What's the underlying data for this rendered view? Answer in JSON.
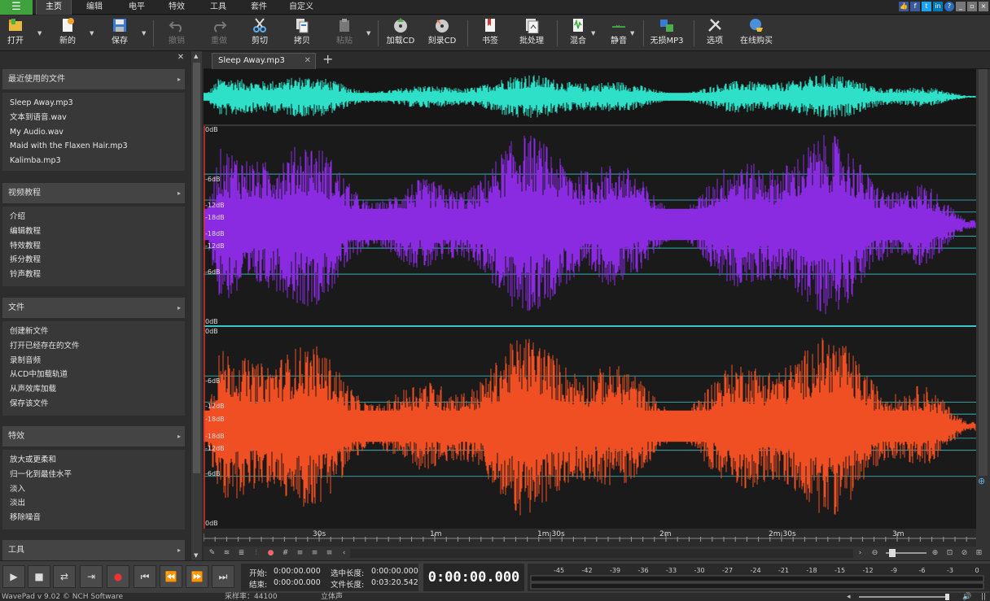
{
  "menu": {
    "items": [
      "主页",
      "编辑",
      "电平",
      "特效",
      "工具",
      "套件",
      "自定义"
    ]
  },
  "toolbar": {
    "open": "打开",
    "new": "新的",
    "save": "保存",
    "undo": "撤销",
    "redo": "重做",
    "cut": "剪切",
    "copy": "拷贝",
    "paste": "粘贴",
    "load_cd": "加载CD",
    "burn_cd": "刻录CD",
    "bookmark": "书签",
    "batch": "批处理",
    "mix": "混合",
    "silence": "静音",
    "lossless_mp3": "无损MP3",
    "options": "选项",
    "buy_online": "在线购买"
  },
  "sidebar": {
    "recent": {
      "title": "最近使用的文件",
      "items": [
        "Sleep Away.mp3",
        "文本到语音.wav",
        "My Audio.wav",
        "Maid with the Flaxen Hair.mp3",
        "Kalimba.mp3"
      ]
    },
    "video": {
      "title": "视频教程",
      "items": [
        "介绍",
        "编辑教程",
        "特效教程",
        "拆分教程",
        "铃声教程"
      ]
    },
    "file": {
      "title": "文件",
      "items": [
        "创建新文件",
        "打开已经存在的文件",
        "录制音频",
        "从CD中加载轨道",
        "从声效库加载",
        "保存该文件"
      ]
    },
    "effects": {
      "title": "特效",
      "items": [
        "放大或更柔和",
        "归一化到最佳水平",
        "淡入",
        "淡出",
        "移除噪音"
      ]
    },
    "tools": {
      "title": "工具"
    }
  },
  "tab": {
    "name": "Sleep Away.mp3"
  },
  "db_labels": {
    "l1": "0dB",
    "l2": "-6dB",
    "l3": "-12dB",
    "l4": "-18dB",
    "l5": "-18dB",
    "l6": "-12dB",
    "l7": "-6dB",
    "l8": "0dB"
  },
  "db_labels_r": {
    "l1": "0dB",
    "l2": "-6dB",
    "l3": "-12dB",
    "l4": "-18dB",
    "l5": "-18dB",
    "l6": "-12dB",
    "l7": "-6dB",
    "l8": "0dB"
  },
  "timeline": {
    "labels": [
      "30s",
      "1m",
      "1m:30s",
      "2m",
      "2m:30s",
      "3m"
    ]
  },
  "colors": {
    "overview": "#2ee0c8",
    "left": "#8a2be2",
    "right": "#f04e23",
    "guide": "#3bc6c6"
  },
  "transport": {
    "start_label": "开始:",
    "start_value": "0:00:00.000",
    "end_label": "结束:",
    "end_value": "0:00:00.000",
    "sel_len_label": "选中长度:",
    "sel_len_value": "0:00:00.000",
    "file_len_label": "文件长度:",
    "file_len_value": "0:03:20.542",
    "position": "0:00:00.000"
  },
  "meter": {
    "labels": [
      "-45",
      "-42",
      "-39",
      "-36",
      "-33",
      "-30",
      "-27",
      "-24",
      "-21",
      "-18",
      "-15",
      "-12",
      "-9",
      "-6",
      "-3",
      "0"
    ]
  },
  "status": {
    "version": "WavePad v 9.02 © NCH Software",
    "sample_rate": "采样率：44100",
    "mode": "立体声"
  }
}
